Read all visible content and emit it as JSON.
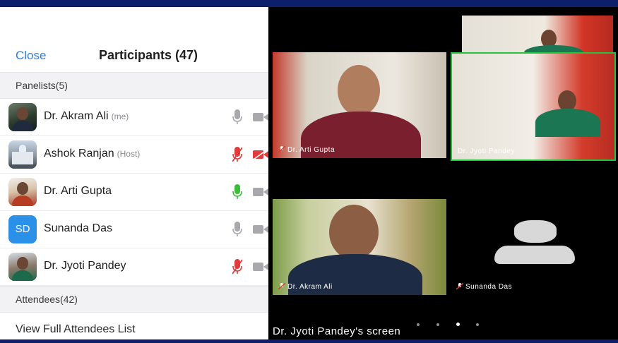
{
  "participants_panel": {
    "close_label": "Close",
    "title": "Participants (47)",
    "panelists_header": "Panelists(5)",
    "panelists": [
      {
        "name": "Dr. Akram Ali",
        "role": "(me)",
        "avatar_initials": "",
        "mic": "on",
        "video": "off"
      },
      {
        "name": "Ashok Ranjan",
        "role": "(Host)",
        "avatar_initials": "",
        "mic": "muted",
        "video": "muted"
      },
      {
        "name": "Dr. Arti Gupta",
        "role": "",
        "avatar_initials": "",
        "mic": "speaking",
        "video": "off"
      },
      {
        "name": "Sunanda Das",
        "role": "",
        "avatar_initials": "SD",
        "mic": "on",
        "video": "off"
      },
      {
        "name": "Dr. Jyoti Pandey",
        "role": "",
        "avatar_initials": "",
        "mic": "muted",
        "video": "off"
      }
    ],
    "attendees_header": "Attendees(42)",
    "view_attendees_label": "View Full Attendees List"
  },
  "meeting_view": {
    "tiles": [
      {
        "name": "Dr. Arti Gupta"
      },
      {
        "name": "Dr. Jyoti Pandey"
      },
      {
        "name": "Dr. Akram Ali"
      },
      {
        "name": "Sunanda Das"
      }
    ],
    "share_caption": "Dr. Jyoti Pandey's screen",
    "page_count": 4,
    "active_page": 3
  },
  "colors": {
    "accent_blue": "#2d7ee0",
    "muted_red": "#e23b3b",
    "speaking_green": "#3bbf3b",
    "active_border": "#27c23c",
    "frame_navy": "#0c1f6b"
  },
  "icons": {
    "mic": "microphone-icon",
    "mic_muted": "microphone-muted-icon",
    "video": "video-camera-icon",
    "video_muted": "video-camera-muted-icon"
  }
}
